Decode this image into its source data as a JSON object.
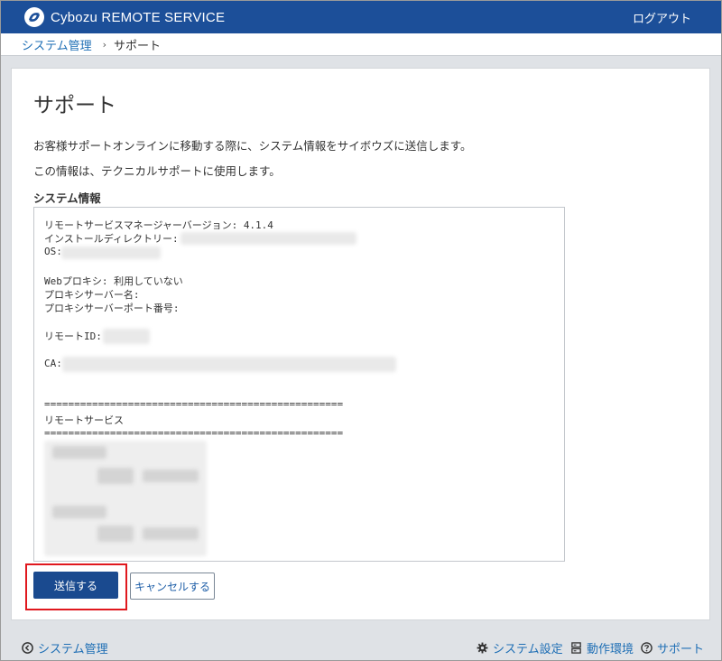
{
  "header": {
    "app_name": "Cybozu REMOTE SERVICE",
    "logout_label": "ログアウト"
  },
  "breadcrumb": {
    "parent": "システム管理",
    "separator": "›",
    "current": "サポート"
  },
  "main": {
    "title": "サポート",
    "description_1": "お客様サポートオンラインに移動する際に、システム情報をサイボウズに送信します。",
    "description_2": "この情報は、テクニカルサポートに使用します。",
    "section_label": "システム情報",
    "info_lines": {
      "version": "リモートサービスマネージャーバージョン: 4.1.4",
      "install_dir": "インストールディレクトリー:",
      "os": "OS:",
      "web_proxy": "Webプロキシ: 利用していない",
      "proxy_server": "プロキシサーバー名:",
      "proxy_port": "プロキシサーバーポート番号:",
      "remote_id": "リモートID:",
      "ca": "CA:",
      "separator_1": "==================================================",
      "remote_service": "リモートサービス",
      "separator_2": "=================================================="
    },
    "send_button": "送信する",
    "cancel_button": "キャンセルする"
  },
  "footer": {
    "system_admin": "システム管理",
    "system_settings": "システム設定",
    "environment": "動作環境",
    "support": "サポート"
  },
  "colors": {
    "header_bg": "#1c4f99",
    "primary_button": "#1a4a8f",
    "link": "#1f6fb5",
    "highlight": "#e0181e"
  }
}
